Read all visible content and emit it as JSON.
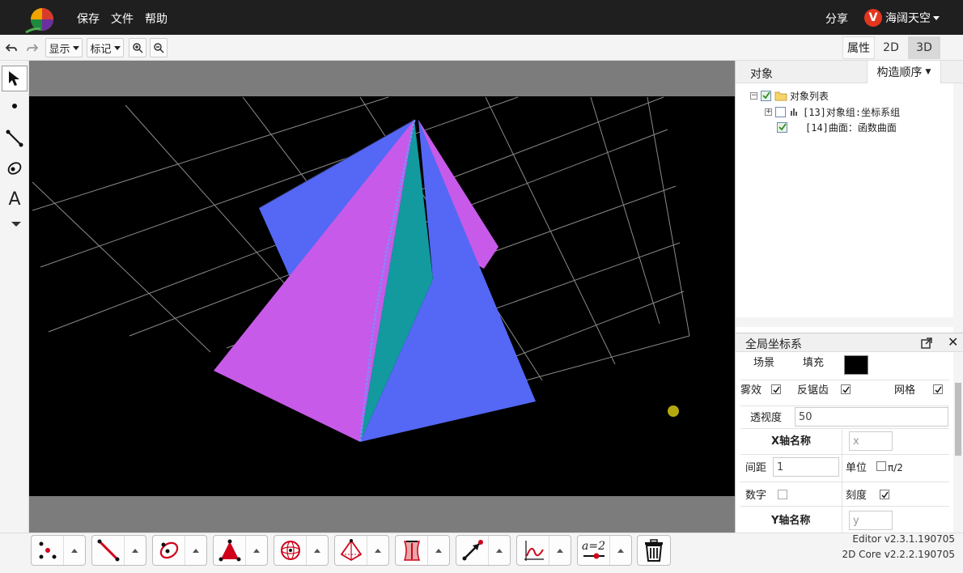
{
  "menubar": {
    "items": [
      "保存",
      "文件",
      "帮助"
    ],
    "share_label": "分享",
    "user_initial": "V",
    "user_name": "海阔天空"
  },
  "toolbar": {
    "display_label": "显示",
    "mark_label": "标记",
    "properties_tab": "属性",
    "tab_2d": "2D",
    "tab_3d": "3D"
  },
  "panel": {
    "tab_objects": "对象",
    "tab_order": "构造顺序",
    "tree": [
      {
        "text": "对象列表",
        "checked": true
      },
      {
        "text": "[13]对象组:坐标系组",
        "checked": false
      },
      {
        "text": "[14]曲面：函数曲面",
        "checked": true
      }
    ],
    "props_title": "全局坐标系",
    "props": {
      "scene": "场景",
      "fill": "填充",
      "fill_color": "#000000",
      "fog": "雾效",
      "antialias": "反锯齿",
      "grid": "网格",
      "perspective": "透视度",
      "perspective_value": "50",
      "x_axis_name": "X轴名称",
      "x_axis_placeholder": "x",
      "spacing": "间距",
      "spacing_value": "1",
      "unit": "单位",
      "unit_option": "π/2",
      "number": "数字",
      "ticks": "刻度",
      "y_axis_name": "Y轴名称",
      "y_axis_placeholder": "y"
    }
  },
  "version": {
    "editor": "Editor v2.3.1.190705",
    "core": "2D Core v2.2.2.190705"
  },
  "bottom_tools": [
    "point-tool",
    "segment-tool",
    "conic-tool",
    "polygon-tool",
    "sphere-tool",
    "solid-tool",
    "surface-tool",
    "transform-tool",
    "function-tool",
    "equation-tool",
    "delete-tool"
  ],
  "equation_label": "a=2",
  "colors": {
    "surface_violet": "#c75ae8",
    "surface_blue": "#5468f5",
    "surface_teal": "#129a9f",
    "grid_line": "#8a8a8a",
    "point": "#b5a80f"
  }
}
